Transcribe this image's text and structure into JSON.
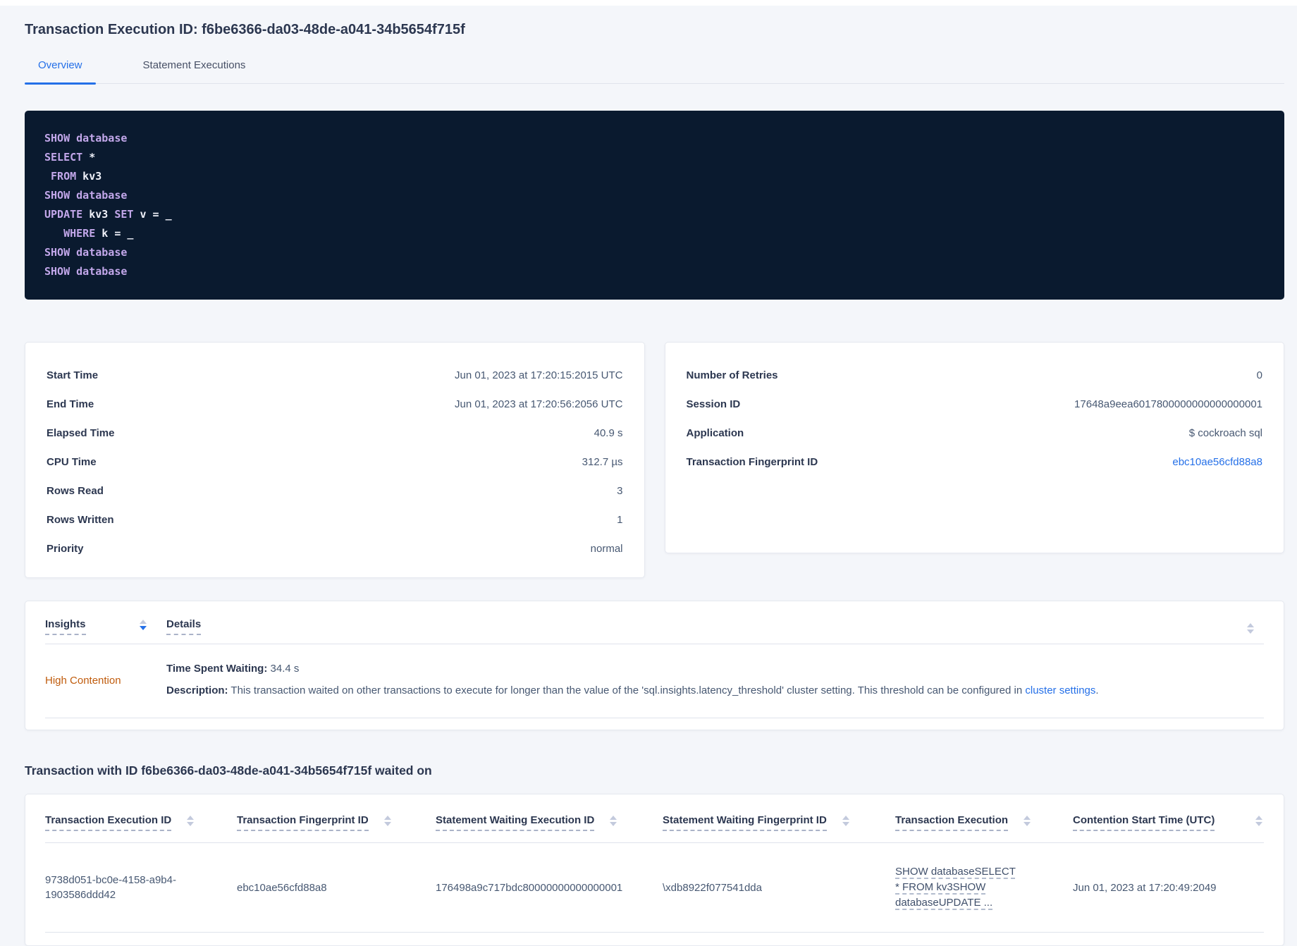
{
  "page": {
    "title": "Transaction Execution ID: f6be6366-da03-48de-a041-34b5654f715f"
  },
  "tabs": [
    {
      "label": "Overview",
      "active": true
    },
    {
      "label": "Statement Executions",
      "active": false
    }
  ],
  "sql_box": {
    "lines": [
      [
        {
          "t": "SHOW",
          "k": true
        },
        {
          "t": " "
        },
        {
          "t": "database",
          "k": true
        }
      ],
      [
        {
          "t": "SELECT",
          "k": true
        },
        {
          "t": " *"
        }
      ],
      [
        {
          "t": " "
        },
        {
          "t": "FROM",
          "k": true
        },
        {
          "t": " kv3"
        }
      ],
      [
        {
          "t": "SHOW",
          "k": true
        },
        {
          "t": " "
        },
        {
          "t": "database",
          "k": true
        }
      ],
      [
        {
          "t": "UPDATE",
          "k": true
        },
        {
          "t": " kv3 "
        },
        {
          "t": "SET",
          "k": true
        },
        {
          "t": " v = _"
        }
      ],
      [
        {
          "t": "   "
        },
        {
          "t": "WHERE",
          "k": true
        },
        {
          "t": " k = _"
        }
      ],
      [
        {
          "t": "SHOW",
          "k": true
        },
        {
          "t": " "
        },
        {
          "t": "database",
          "k": true
        }
      ],
      [
        {
          "t": "SHOW",
          "k": true
        },
        {
          "t": " "
        },
        {
          "t": "database",
          "k": true
        }
      ]
    ]
  },
  "summary_left": {
    "rows": [
      {
        "label": "Start Time",
        "value": "Jun 01, 2023 at 17:20:15:2015 UTC"
      },
      {
        "label": "End Time",
        "value": "Jun 01, 2023 at 17:20:56:2056 UTC"
      },
      {
        "label": "Elapsed Time",
        "value": "40.9 s"
      },
      {
        "label": "CPU Time",
        "value": "312.7 µs"
      },
      {
        "label": "Rows Read",
        "value": "3"
      },
      {
        "label": "Rows Written",
        "value": "1"
      },
      {
        "label": "Priority",
        "value": "normal"
      }
    ]
  },
  "summary_right": {
    "rows": [
      {
        "label": "Number of Retries",
        "value": "0"
      },
      {
        "label": "Session ID",
        "value": "17648a9eea6017800000000000000001"
      },
      {
        "label": "Application",
        "value": "$ cockroach sql"
      },
      {
        "label": "Transaction Fingerprint ID",
        "value": "ebc10ae56cfd88a8",
        "link": true
      }
    ]
  },
  "insights_table": {
    "columns": {
      "insights": "Insights",
      "details": "Details"
    },
    "row": {
      "insight": "High Contention",
      "waiting_label": "Time Spent Waiting:",
      "waiting_value": " 34.4 s",
      "desc_label": "Description:",
      "desc_before": " This transaction waited on other transactions to execute for longer than the value of the 'sql.insights.latency_threshold' cluster setting. This threshold can be configured in ",
      "desc_link": "cluster settings",
      "desc_after": "."
    }
  },
  "waited_section": {
    "heading": "Transaction with ID f6be6366-da03-48de-a041-34b5654f715f waited on",
    "columns": [
      "Transaction Execution ID",
      "Transaction Fingerprint ID",
      "Statement Waiting Execution ID",
      "Statement Waiting Fingerprint ID",
      "Transaction Execution",
      "Contention Start Time (UTC)"
    ],
    "row": {
      "txn_exec_id": "9738d051-bc0e-4158-a9b4-1903586ddd42",
      "txn_fingerprint_id": "ebc10ae56cfd88a8",
      "stmt_waiting_exec_id": "176498a9c717bdc80000000000000001",
      "stmt_waiting_fingerprint_id": "\\xdb8922f077541dda",
      "txn_execution": "SHOW databaseSELECT * FROM kv3SHOW databaseUPDATE ...",
      "contention_start": "Jun 01, 2023 at 17:20:49:2049"
    }
  },
  "colors": {
    "accent_blue": "#2570e8",
    "warning_orange": "#c05c0d",
    "code_background": "#0a1a2f",
    "code_keyword": "#c2a7ea"
  }
}
